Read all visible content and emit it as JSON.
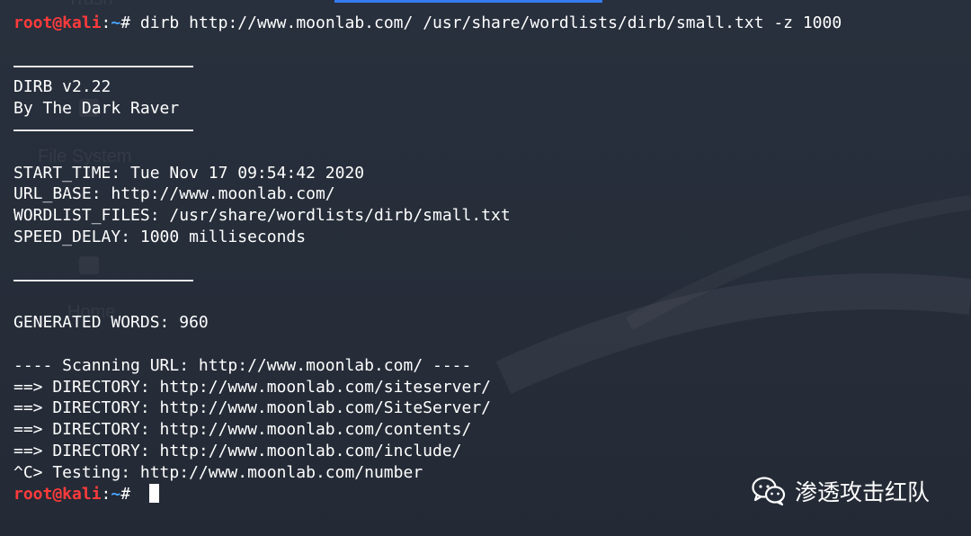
{
  "desktop": {
    "labels": [
      "Trash",
      "File System",
      "Home"
    ]
  },
  "terminal": {
    "prompt_user": "root@kali",
    "prompt_colon": ":",
    "prompt_path": "~",
    "prompt_hash": "# ",
    "command": "dirb http://www.moonlab.com/ /usr/share/wordlists/dirb/small.txt -z 1000",
    "banner_version": "DIRB v2.22",
    "banner_author": "By The Dark Raver",
    "start_time": "START_TIME: Tue Nov 17 09:54:42 2020",
    "url_base": "URL_BASE: http://www.moonlab.com/",
    "wordlist_files": "WORDLIST_FILES: /usr/share/wordlists/dirb/small.txt",
    "speed_delay": "SPEED_DELAY: 1000 milliseconds",
    "generated_words": "GENERATED WORDS: 960",
    "scanning_line": "---- Scanning URL: http://www.moonlab.com/ ----",
    "directories": [
      "==> DIRECTORY: http://www.moonlab.com/siteserver/",
      "==> DIRECTORY: http://www.moonlab.com/SiteServer/",
      "==> DIRECTORY: http://www.moonlab.com/contents/",
      "==> DIRECTORY: http://www.moonlab.com/include/"
    ],
    "testing_line": "^C> Testing: http://www.moonlab.com/number"
  },
  "watermark": {
    "icon": "wechat-icon",
    "text": "渗透攻击红队"
  },
  "colors": {
    "background": "#262d3a",
    "prompt_user": "#ff3b3b",
    "prompt_path": "#4aa3ff",
    "accent": "#367bf0"
  }
}
